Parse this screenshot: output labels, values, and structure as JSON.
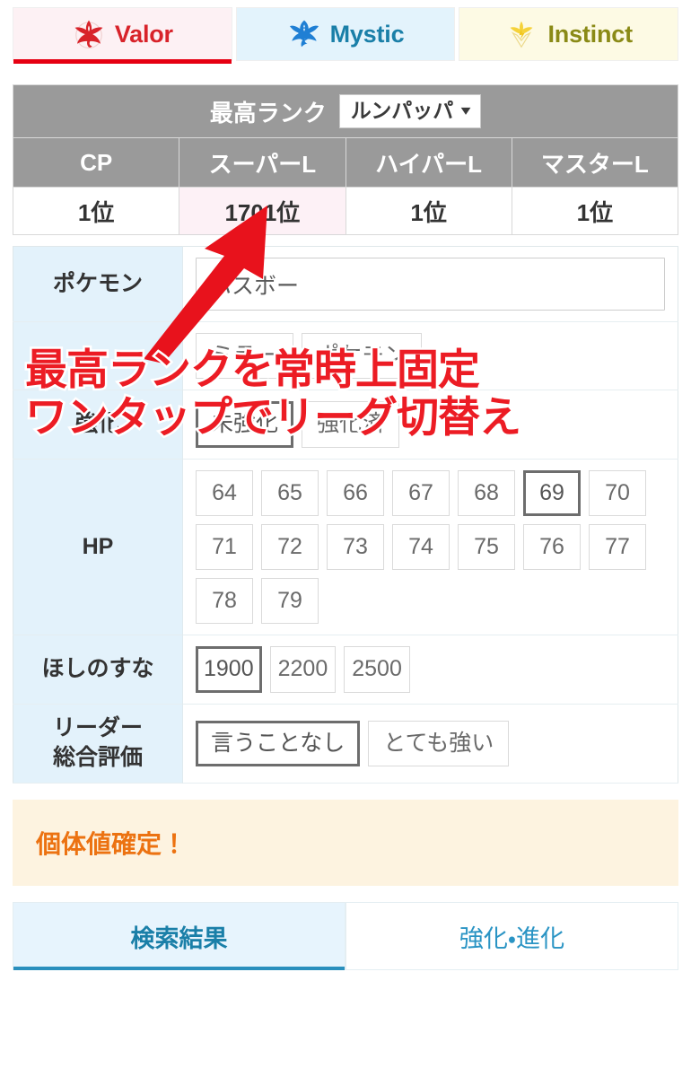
{
  "teams": [
    {
      "id": "valor",
      "label": "Valor",
      "logo": "valor-logo-icon",
      "active": true,
      "color": "#d8232a",
      "bg": "#fdf1f4"
    },
    {
      "id": "mystic",
      "label": "Mystic",
      "logo": "mystic-logo-icon",
      "active": false,
      "color": "#1a7fa8",
      "bg": "#e3f3fc"
    },
    {
      "id": "instinct",
      "label": "Instinct",
      "logo": "instinct-logo-icon",
      "active": false,
      "color": "#8a8a16",
      "bg": "#fdfae4"
    }
  ],
  "rank_table": {
    "title": "最高ランク",
    "pokemon_select": {
      "value": "ルンパッパ",
      "chevron": "chevron-down-icon"
    },
    "columns": [
      "CP",
      "スーパーL",
      "ハイパーL",
      "マスターL"
    ],
    "values": [
      "1位",
      "1701位",
      "1位",
      "1位"
    ],
    "highlight_index": 1,
    "header_bg": "#9a9a9a",
    "highlight_bg": "#fdf1f6"
  },
  "form": {
    "pokemon": {
      "label": "ポケモン",
      "value": "ハスボー",
      "placeholder": "ポケモン"
    },
    "obscured_row": {
      "label": "",
      "chips": [
        "ミラー",
        "ポケモン"
      ]
    },
    "power_up": {
      "label": "強化",
      "chips": [
        {
          "text": "未強化",
          "selected": true
        },
        {
          "text": "強化済",
          "selected": false
        }
      ]
    },
    "hp": {
      "label": "HP",
      "chips": [
        {
          "text": "64",
          "selected": false
        },
        {
          "text": "65",
          "selected": false
        },
        {
          "text": "66",
          "selected": false
        },
        {
          "text": "67",
          "selected": false
        },
        {
          "text": "68",
          "selected": false
        },
        {
          "text": "69",
          "selected": true
        },
        {
          "text": "70",
          "selected": false
        },
        {
          "text": "71",
          "selected": false
        },
        {
          "text": "72",
          "selected": false
        },
        {
          "text": "73",
          "selected": false
        },
        {
          "text": "74",
          "selected": false
        },
        {
          "text": "75",
          "selected": false
        },
        {
          "text": "76",
          "selected": false
        },
        {
          "text": "77",
          "selected": false
        },
        {
          "text": "78",
          "selected": false
        },
        {
          "text": "79",
          "selected": false
        }
      ]
    },
    "stardust": {
      "label": "ほしのすな",
      "chips": [
        {
          "text": "1900",
          "selected": true
        },
        {
          "text": "2200",
          "selected": false
        },
        {
          "text": "2500",
          "selected": false
        }
      ]
    },
    "leader_rating": {
      "label": "リーダー\n総合評価",
      "label_line1": "リーダー",
      "label_line2": "総合評価",
      "chips": [
        {
          "text": "言うことなし",
          "selected": true
        },
        {
          "text": "とても強い",
          "selected": false
        }
      ]
    }
  },
  "result": {
    "text": "個体値確定！",
    "color": "#ec7211",
    "bg": "#fdf3e0"
  },
  "bottom_tabs": [
    {
      "label": "検索結果",
      "active": true
    },
    {
      "label": "強化・進化",
      "active": false
    }
  ],
  "annotation": {
    "line1": "最高ランクを常時上固定",
    "line2": "ワンタップでリーグ切替え",
    "color": "#ec1c24",
    "arrow": "red-arrow-up-icon"
  }
}
